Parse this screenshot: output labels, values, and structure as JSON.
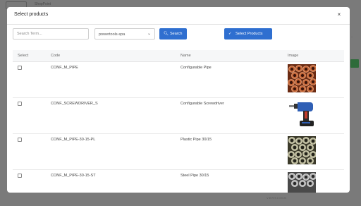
{
  "background": {
    "brand": "ShopPoint",
    "versions_label": "VERSIONS"
  },
  "modal": {
    "title": "Select products",
    "close_label": "×"
  },
  "toolbar": {
    "search_placeholder": "Search Term...",
    "store_select_value": "powertools-spa",
    "search_button_label": "Search",
    "select_products_label": "Select Products"
  },
  "table": {
    "columns": [
      "Select",
      "Code",
      "Name",
      "Image"
    ],
    "rows": [
      {
        "code": "CONF_M_PIPE",
        "name": "Configurable Pipe",
        "image": "copper-pipes-image"
      },
      {
        "code": "CONF_SCREWDRIVER_S",
        "name": "Configurable Screwdriver",
        "image": "cordless-drill-image"
      },
      {
        "code": "CONF_M_PIPE-30-15-PL",
        "name": "Plastic Pipe 30/15",
        "image": "plastic-pipes-image"
      },
      {
        "code": "CONF_M_PIPE-30-15-ST",
        "name": "Steel Pipe 30/15",
        "image": "steel-pipes-image"
      }
    ]
  },
  "colors": {
    "primary": "#2f6fd0",
    "overlay": "#6f6f6f"
  }
}
